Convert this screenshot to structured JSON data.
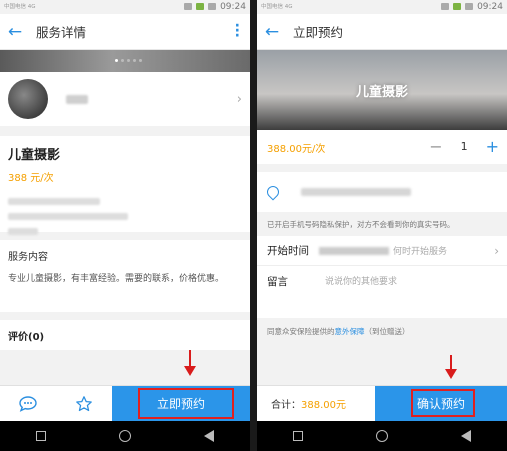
{
  "left": {
    "statusbar": {
      "carrier": "中国电信 4G",
      "time": "09:24"
    },
    "header": {
      "title": "服务详情"
    },
    "service": {
      "name": "儿童摄影",
      "price": "388 元/次"
    },
    "description": {
      "title": "服务内容",
      "text": "专业儿童摄影，有丰富经验。需要的联系，价格优惠。"
    },
    "reviews": {
      "label": "评价(0)"
    },
    "bottom": {
      "book_label": "立即预约"
    }
  },
  "right": {
    "statusbar": {
      "carrier": "中国电信 4G",
      "time": "09:24"
    },
    "header": {
      "title": "立即预约"
    },
    "hero": {
      "text": "儿童摄影"
    },
    "price": "388.00元/次",
    "stepper": {
      "minus": "−",
      "quantity": "1",
      "plus": "+"
    },
    "privacy_note": "已开启手机号码隐私保护，对方不会看到你的真实号码。",
    "start_time": {
      "label": "开始时间",
      "hint": "何时开始服务"
    },
    "message": {
      "label": "留言",
      "placeholder": "说说你的其他要求"
    },
    "insurance": {
      "prefix": "同意众安保险提供的",
      "link": "意外保障",
      "suffix": "（到位赠送）"
    },
    "total": {
      "label": "合计：",
      "amount": "388.00元"
    },
    "confirm_label": "确认预约"
  },
  "accent_color": "#2b95e9",
  "price_color": "#f5a000",
  "highlight_color": "#e02020"
}
